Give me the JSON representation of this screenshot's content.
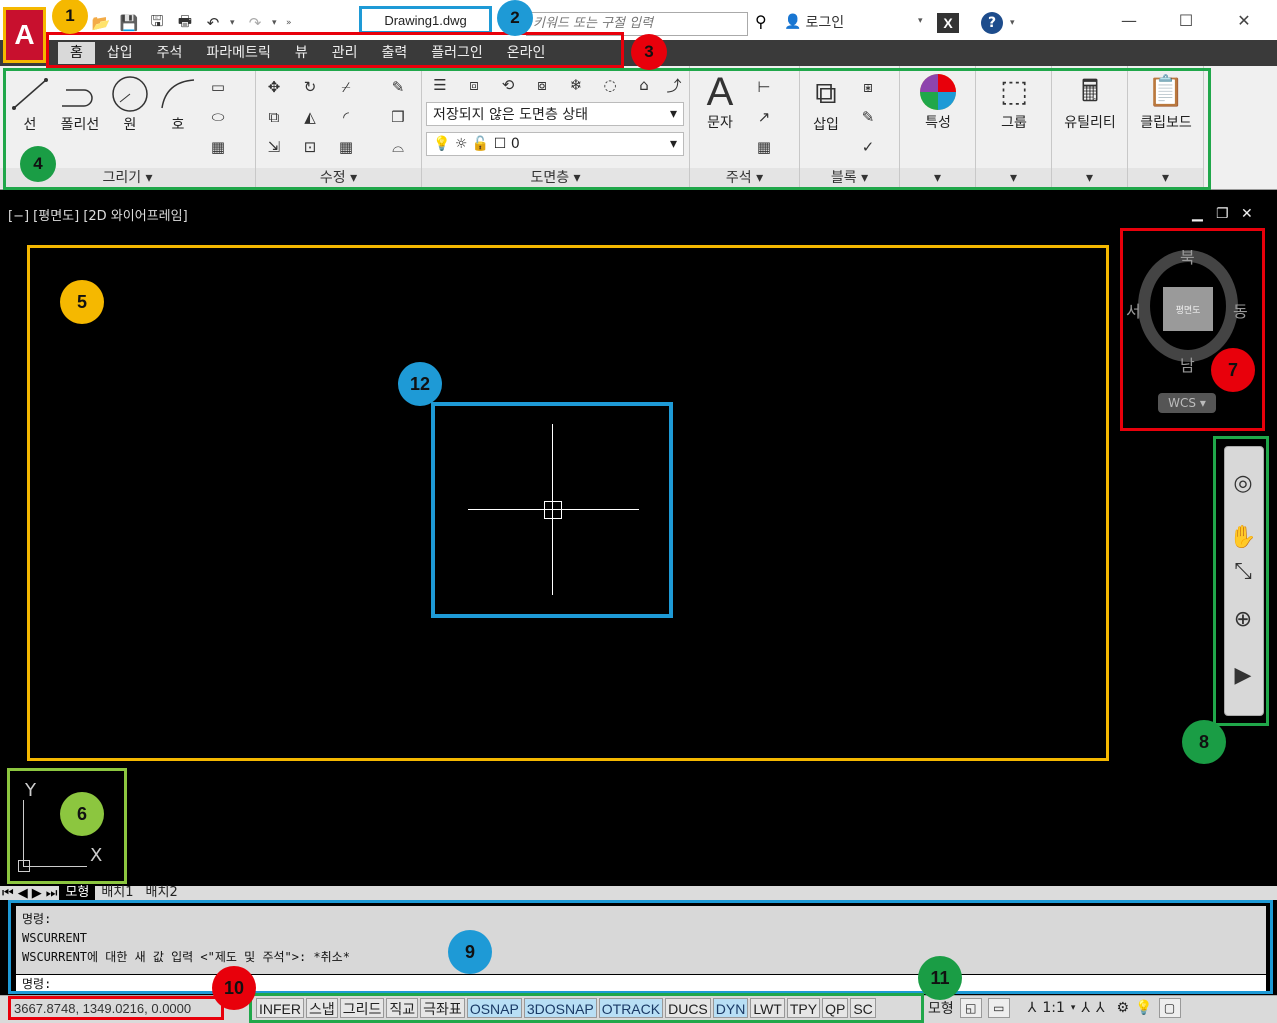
{
  "titlebar": {
    "document_title": "Drawing1.dwg",
    "search_placeholder": "키워드 또는 구절 입력",
    "login_label": "로그인",
    "exchange_label": "X",
    "help_label": "?"
  },
  "ribbon_tabs": [
    "홈",
    "삽입",
    "주석",
    "파라메트릭",
    "뷰",
    "관리",
    "출력",
    "플러그인",
    "온라인"
  ],
  "ribbon_panels": {
    "draw": {
      "label": "그리기",
      "tools": [
        "선",
        "폴리선",
        "원",
        "호"
      ]
    },
    "modify": {
      "label": "수정"
    },
    "layers": {
      "label": "도면층",
      "layer_state": "저장되지 않은 도면층 상태",
      "current_layer": "0"
    },
    "annotation": {
      "label": "주석",
      "tools": [
        "문자"
      ]
    },
    "block": {
      "label": "블록",
      "tools": [
        "삽입"
      ]
    },
    "properties": {
      "label": "특성"
    },
    "groups": {
      "label": "그룹"
    },
    "utilities": {
      "label": "유틸리티"
    },
    "clipboard": {
      "label": "클립보드"
    }
  },
  "viewport": {
    "label": "[−] [평면도] [2D 와이어프레임]"
  },
  "viewcube": {
    "north": "북",
    "south": "남",
    "east": "동",
    "west": "서",
    "face": "평면도",
    "wcs": "WCS"
  },
  "ucs": {
    "x": "X",
    "y": "Y"
  },
  "layout_tabs": [
    "모형",
    "배치1",
    "배치2"
  ],
  "command_line": {
    "history": [
      "명령:",
      "WSCURRENT",
      "WSCURRENT에 대한 새 값 입력 <\"제도 및 주석\">: *취소*"
    ],
    "prompt": "명령:"
  },
  "statusbar": {
    "coordinates": "3667.8748, 1349.0216, 0.0000",
    "toggles": [
      {
        "label": "INFER",
        "on": false
      },
      {
        "label": "스냅",
        "on": false
      },
      {
        "label": "그리드",
        "on": false
      },
      {
        "label": "직교",
        "on": false
      },
      {
        "label": "극좌표",
        "on": false
      },
      {
        "label": "OSNAP",
        "on": true
      },
      {
        "label": "3DOSNAP",
        "on": true
      },
      {
        "label": "OTRACK",
        "on": true
      },
      {
        "label": "DUCS",
        "on": false
      },
      {
        "label": "DYN",
        "on": true
      },
      {
        "label": "LWT",
        "on": false
      },
      {
        "label": "TPY",
        "on": false
      },
      {
        "label": "QP",
        "on": false
      },
      {
        "label": "SC",
        "on": false
      }
    ],
    "model_label": "모형",
    "scale": "1:1"
  },
  "badges": [
    "1",
    "2",
    "3",
    "4",
    "5",
    "6",
    "7",
    "8",
    "9",
    "10",
    "11",
    "12"
  ],
  "colors": {
    "highlight_yellow": "#f5b800",
    "highlight_blue": "#1e9ad6",
    "highlight_red": "#e8000b",
    "highlight_green": "#1a9d45",
    "highlight_lime": "#8cc63f"
  }
}
